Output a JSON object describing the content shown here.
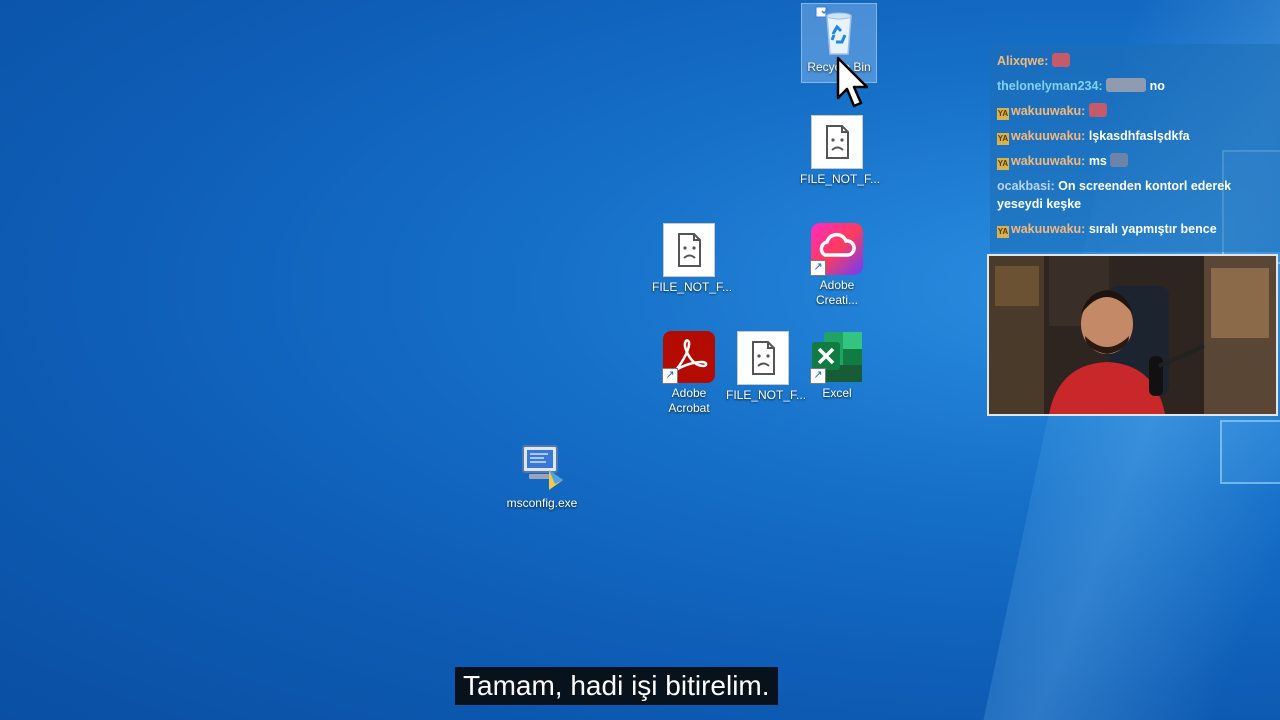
{
  "desktop": {
    "icons": [
      {
        "label": "Recycle Bin"
      },
      {
        "label": "FILE_NOT_F..."
      },
      {
        "label": "FILE_NOT_F..."
      },
      {
        "label": "Adobe Creati..."
      },
      {
        "label": "Adobe Acrobat"
      },
      {
        "label": "FILE_NOT_F..."
      },
      {
        "label": "Excel"
      },
      {
        "label": "msconfig.exe"
      }
    ]
  },
  "chat": {
    "messages": [
      {
        "user": "Alixqwe:",
        "text": "",
        "user_color": "#f4b97a"
      },
      {
        "user": "thelonelyman234:",
        "text": "no",
        "user_color": "#7fd3f2"
      },
      {
        "user": "wakuuwaku:",
        "text": "",
        "user_color": "#f4b97a"
      },
      {
        "user": "wakuuwaku:",
        "text": "lşkasdhfaslşdkfa",
        "user_color": "#f4b97a"
      },
      {
        "user": "wakuuwaku:",
        "text": "ms",
        "user_color": "#f4b97a"
      },
      {
        "user": "ocakbasi:",
        "text": "On screenden kontorl ederek yeseydi keşke",
        "user_color": "#bcd2f5"
      },
      {
        "user": "wakuuwaku:",
        "text": "sıralı yapmıştır bence",
        "user_color": "#f4b97a"
      }
    ]
  },
  "webcam": {
    "icon": "streamer-webcam"
  },
  "subtitle": {
    "text": "Tamam, hadi işi bitirelim."
  },
  "colors": {
    "excel": "#1d7044",
    "acrobat": "#b30b00",
    "subtitle_bg": "#0a0a0a"
  }
}
